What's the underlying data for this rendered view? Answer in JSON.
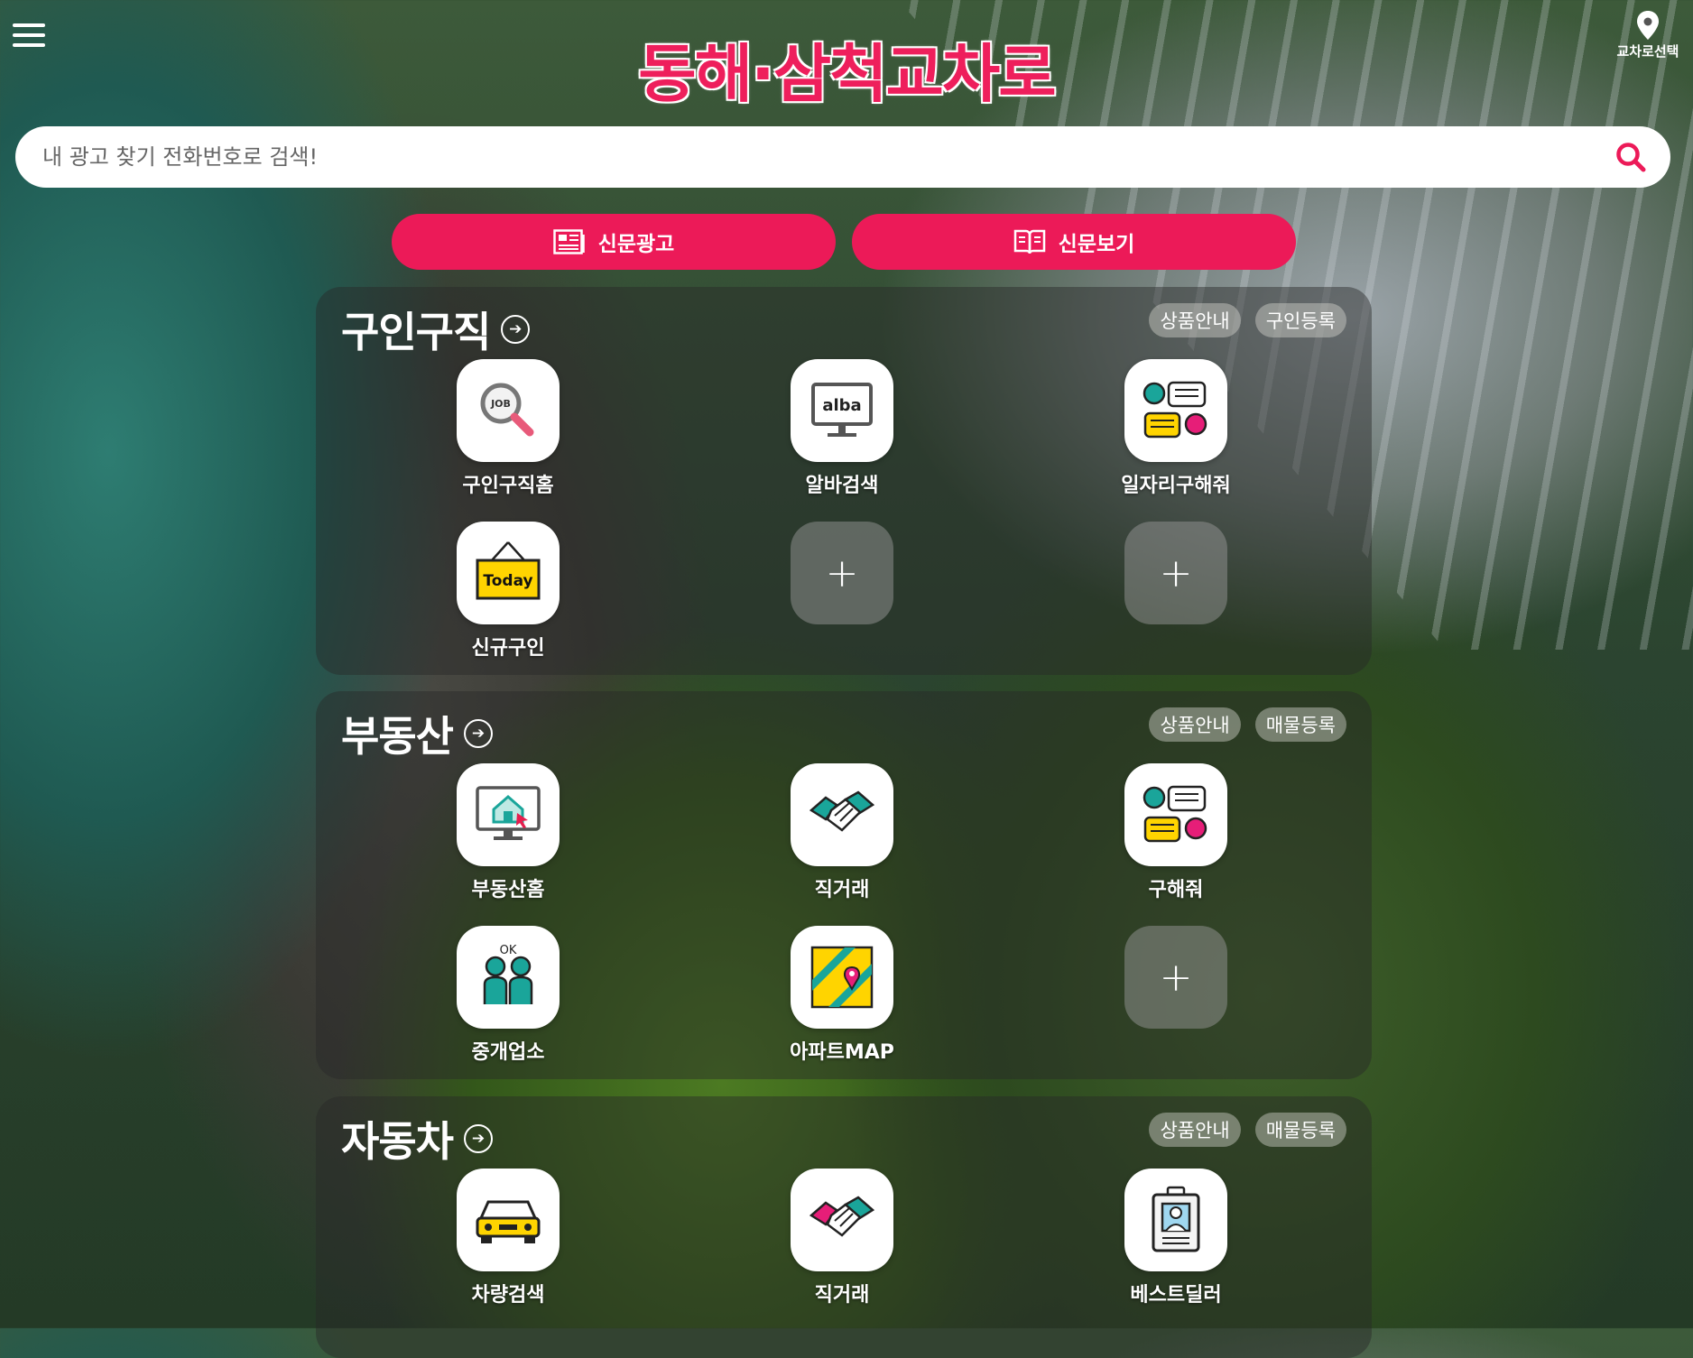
{
  "header": {
    "logo": "동해·삼척교차로",
    "region_label": "교차로선택"
  },
  "search": {
    "placeholder": "내 광고 찾기 전화번호로 검색!"
  },
  "pills": {
    "ad": "신문광고",
    "view": "신문보기"
  },
  "sections": [
    {
      "title": "구인구직",
      "btn1": "상품안내",
      "btn2": "구인등록",
      "items": [
        {
          "label": "구인구직홈",
          "icon": "job-search-icon"
        },
        {
          "label": "알바검색",
          "icon": "alba-monitor-icon"
        },
        {
          "label": "일자리구해줘",
          "icon": "chat-people-icon"
        },
        {
          "label": "신규구인",
          "icon": "today-sign-icon"
        }
      ]
    },
    {
      "title": "부동산",
      "btn1": "상품안내",
      "btn2": "매물등록",
      "items": [
        {
          "label": "부동산홈",
          "icon": "house-monitor-icon"
        },
        {
          "label": "직거래",
          "icon": "handshake-icon"
        },
        {
          "label": "구해줘",
          "icon": "chat-people-icon"
        },
        {
          "label": "중개업소",
          "icon": "agents-ok-icon"
        },
        {
          "label": "아파트MAP",
          "icon": "map-pin-icon"
        }
      ]
    },
    {
      "title": "자동차",
      "btn1": "상품안내",
      "btn2": "매물등록",
      "items": [
        {
          "label": "차량검색",
          "icon": "car-icon"
        },
        {
          "label": "직거래",
          "icon": "handshake-icon"
        },
        {
          "label": "베스트딜러",
          "icon": "id-badge-icon"
        }
      ]
    }
  ],
  "colors": {
    "accent": "#ec1a58",
    "logo": "#ee1f5c",
    "teal": "#1aa59a",
    "yellow": "#ffd400"
  }
}
